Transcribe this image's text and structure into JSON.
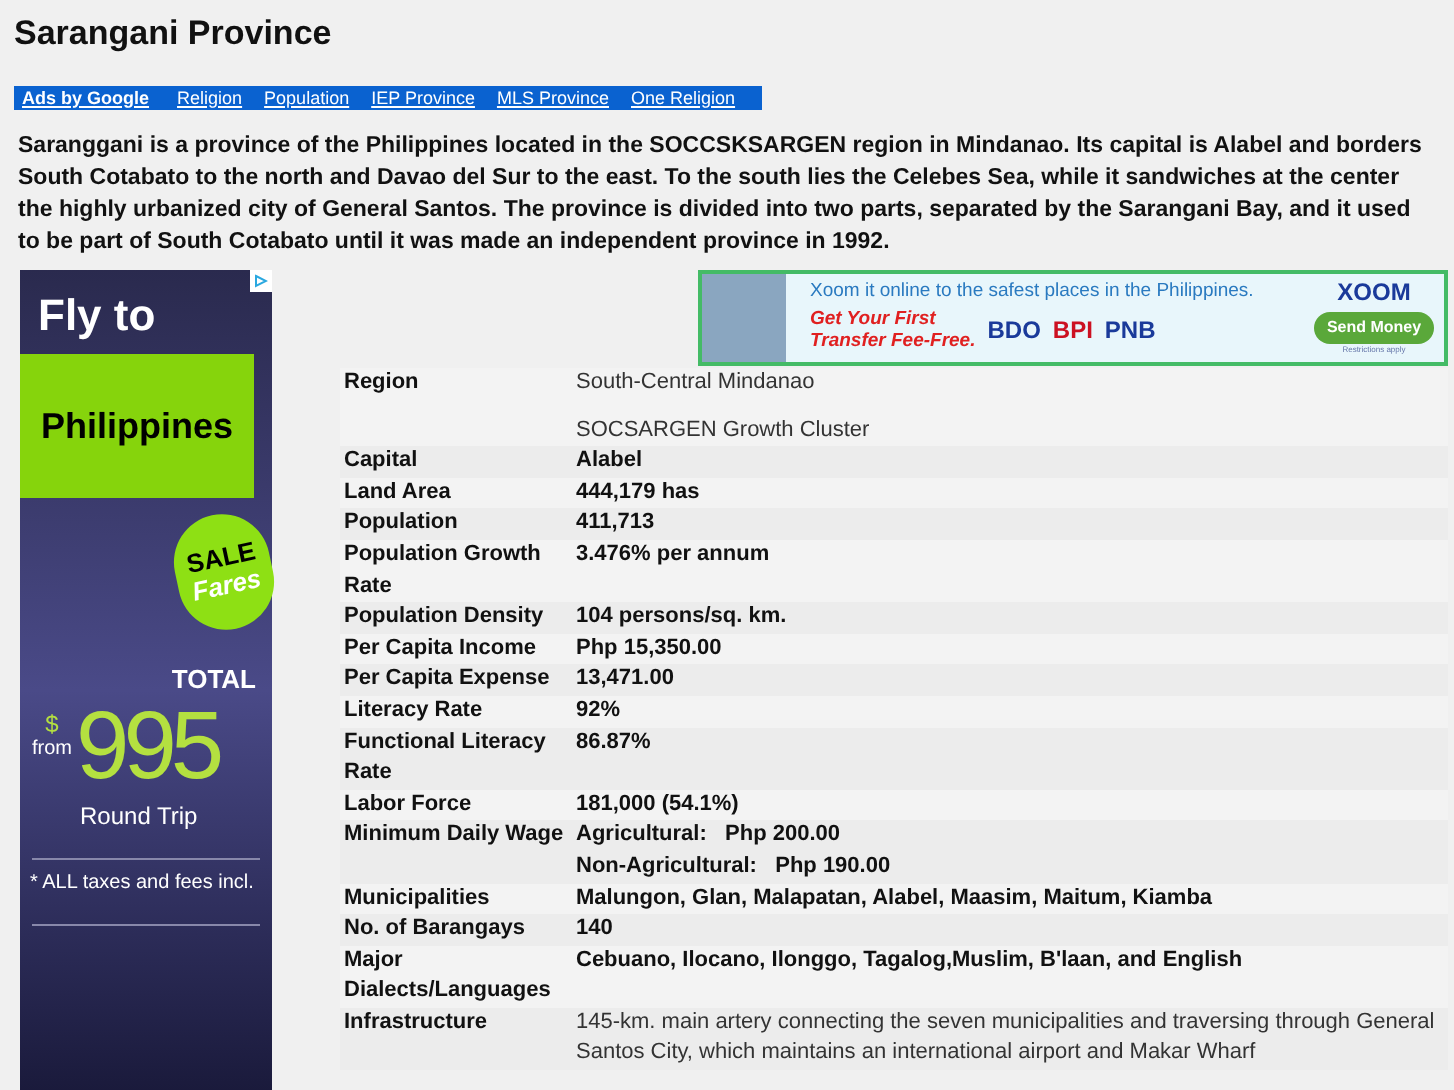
{
  "title": "Sarangani Province",
  "nav": {
    "label": "Ads by Google",
    "links": [
      "Religion",
      "Population",
      "IEP Province",
      "MLS Province",
      "One Religion"
    ]
  },
  "intro": "Saranggani is a province of the Philippines located in the SOCCSKSARGEN region in Mindanao. Its capital is Alabel and borders South Cotabato to the north and Davao del Sur to the east. To the south lies the Celebes Sea, while it sandwiches at the center the highly urbanized city of General Santos. The province is divided into two parts, separated by the Sarangani Bay, and it used to be part of South Cotabato until it was made an independent province in 1992.",
  "side_ad": {
    "headline": "Fly to",
    "destination": "Philippines",
    "burst": [
      "SALE",
      "Fares"
    ],
    "total": "TOTAL",
    "currency": "$",
    "from": "from",
    "price": "995",
    "trip": "Round Trip",
    "note": "* ALL taxes and fees incl."
  },
  "banner_ad": {
    "tagline": "Xoom it online to the safest places in the Philippines.",
    "offer": [
      "Get Your First",
      "Transfer Fee-Free."
    ],
    "banks": [
      "BDO",
      "BPI",
      "PNB"
    ],
    "brand": "XOOM",
    "button": "Send Money",
    "fine_print": "Restrictions apply"
  },
  "facts": [
    {
      "label": "Region",
      "kind": "plain",
      "lines": [
        "South-Central Mindanao"
      ],
      "note": "SOCSARGEN Growth Cluster"
    },
    {
      "label": "Capital",
      "kind": "bold",
      "lines": [
        "Alabel"
      ]
    },
    {
      "label": "Land Area",
      "kind": "bold",
      "lines": [
        "444,179 has"
      ]
    },
    {
      "label": "Population",
      "kind": "bold",
      "lines": [
        "411,713"
      ]
    },
    {
      "label": "Population Growth Rate",
      "kind": "bold",
      "lines": [
        "3.476% per annum"
      ]
    },
    {
      "label": "Population Density",
      "kind": "bold",
      "lines": [
        "104 persons/sq. km."
      ]
    },
    {
      "label": "Per Capita Income",
      "kind": "bold",
      "lines": [
        "Php 15,350.00"
      ]
    },
    {
      "label": "Per Capita Expense",
      "kind": "bold",
      "lines": [
        "13,471.00"
      ]
    },
    {
      "label": "Literacy Rate",
      "kind": "bold",
      "lines": [
        "92%"
      ]
    },
    {
      "label": "Functional Literacy Rate",
      "kind": "bold",
      "lines": [
        "86.87%"
      ]
    },
    {
      "label": "Labor Force",
      "kind": "bold",
      "lines": [
        "181,000 (54.1%)"
      ]
    },
    {
      "label": "Minimum Daily Wage",
      "kind": "bold",
      "lines": [
        "Agricultural:   Php 200.00",
        "Non-Agricultural:   Php 190.00"
      ]
    },
    {
      "label": "Municipalities",
      "kind": "bold",
      "lines": [
        "Malungon, Glan, Malapatan, Alabel, Maasim, Maitum, Kiamba"
      ]
    },
    {
      "label": "No. of Barangays",
      "kind": "bold",
      "lines": [
        "140"
      ]
    },
    {
      "label": "Major Dialects/Languages",
      "kind": "bold",
      "lines": [
        "Cebuano, Ilocano, Ilonggo, Tagalog,Muslim, B'laan, and English"
      ]
    },
    {
      "label": "Infrastructure",
      "kind": "plain",
      "lines": [
        "145-km. main artery connecting the seven municipalities and traversing through General Santos City, which maintains an international airport and Makar Wharf"
      ]
    }
  ]
}
